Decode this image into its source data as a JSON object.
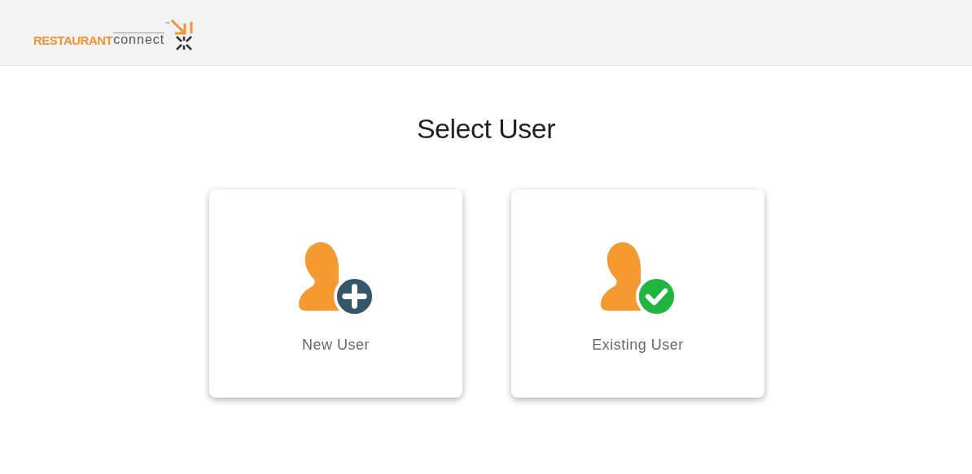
{
  "header": {
    "logo": {
      "word_1": "RESTAURANT",
      "word_2": "connect",
      "trademark": "™"
    }
  },
  "title": "Select User",
  "options": [
    {
      "kind": "new",
      "label": "New User"
    },
    {
      "kind": "existing",
      "label": "Existing User"
    }
  ]
}
